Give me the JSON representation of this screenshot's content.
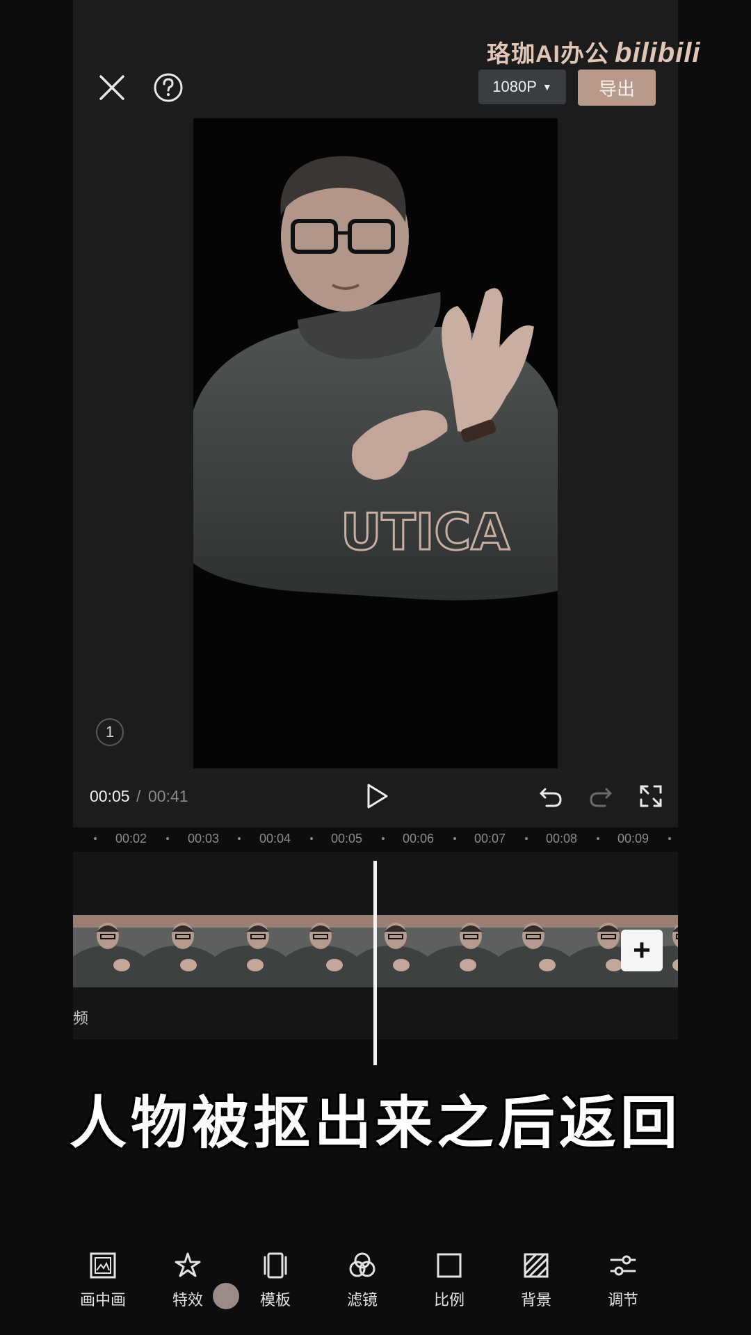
{
  "watermark": {
    "text": "珞珈AI办公",
    "brand": "bilibili"
  },
  "topbar": {
    "resolution": "1080P",
    "export_label": "导出"
  },
  "preview": {
    "layer_index": "1"
  },
  "playback": {
    "current": "00:05",
    "separator": "/",
    "total": "00:41"
  },
  "ruler": {
    "ticks": [
      "00:02",
      "00:03",
      "00:04",
      "00:05",
      "00:06",
      "00:07",
      "00:08",
      "00:09"
    ]
  },
  "timeline": {
    "track_label": "频",
    "add_label": "+"
  },
  "caption": {
    "text": "人物被抠出来之后返回"
  },
  "toolbar": {
    "items": [
      {
        "label": "画中画",
        "icon": "picture-in-picture-icon"
      },
      {
        "label": "特效",
        "icon": "sparkle-star-icon"
      },
      {
        "label": "模板",
        "icon": "template-cards-icon"
      },
      {
        "label": "滤镜",
        "icon": "filter-circles-icon"
      },
      {
        "label": "比例",
        "icon": "ratio-square-icon"
      },
      {
        "label": "背景",
        "icon": "background-hatch-icon"
      },
      {
        "label": "调节",
        "icon": "adjust-sliders-icon"
      }
    ]
  },
  "colors": {
    "export": "#b89a8c",
    "background": "#0d0d0d",
    "watermark": "#e2c5b5"
  }
}
